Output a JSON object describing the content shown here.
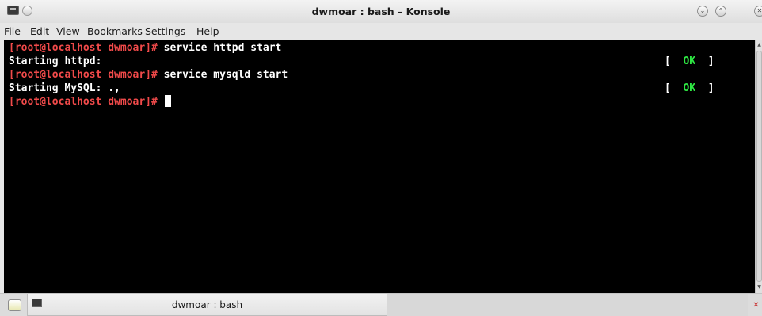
{
  "window": {
    "title": "dwmoar : bash – Konsole",
    "buttons": {
      "minimize": "⌄",
      "maximize": "⌃",
      "close": "✕"
    }
  },
  "menubar": {
    "items": [
      "File",
      "Edit",
      "View",
      "Bookmarks",
      "Settings",
      "Help"
    ]
  },
  "terminal": {
    "lines": [
      {
        "prompt": "[root@localhost dwmoar]#",
        "command": " service httpd start"
      },
      {
        "output": "Starting httpd:",
        "status_open": "[  ",
        "status_ok": "OK",
        "status_close": "  ]"
      },
      {
        "prompt": "[root@localhost dwmoar]#",
        "command": " service mysqld start"
      },
      {
        "output": "Starting MySQL: .,",
        "status_open": "[  ",
        "status_ok": "OK",
        "status_close": "  ]"
      },
      {
        "prompt": "[root@localhost dwmoar]#",
        "command": " "
      }
    ],
    "colors": {
      "background": "#000000",
      "prompt": "#f14a4a",
      "text": "#ffffff",
      "ok": "#2ee843"
    }
  },
  "tabbar": {
    "tabs": [
      {
        "label": "dwmoar : bash"
      }
    ],
    "close_tab": "✕"
  }
}
